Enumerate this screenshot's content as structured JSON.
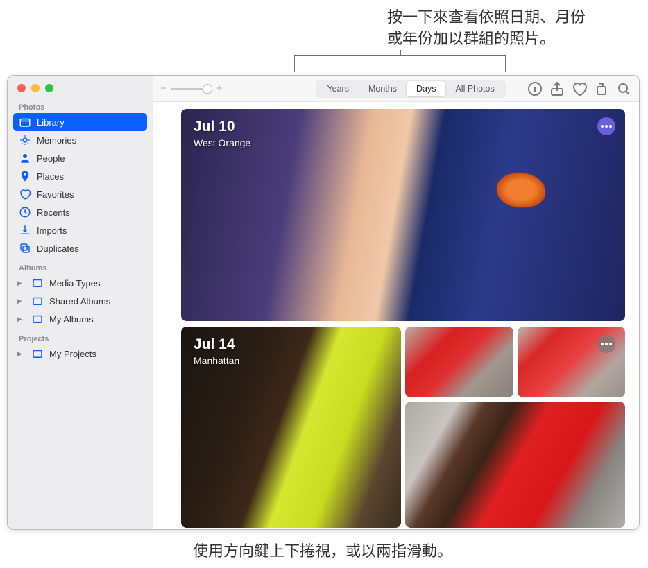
{
  "annotations": {
    "top_line1": "按一下來查看依照日期、月份",
    "top_line2": "或年份加以群組的照片。",
    "bottom": "使用方向鍵上下捲視，或以兩指滑動。"
  },
  "sidebar": {
    "sections": {
      "photos": "Photos",
      "albums": "Albums",
      "projects": "Projects"
    },
    "library": "Library",
    "memories": "Memories",
    "people": "People",
    "places": "Places",
    "favorites": "Favorites",
    "recents": "Recents",
    "imports": "Imports",
    "duplicates": "Duplicates",
    "media_types": "Media Types",
    "shared_albums": "Shared Albums",
    "my_albums": "My Albums",
    "my_projects": "My Projects"
  },
  "toolbar": {
    "zoom_out": "−",
    "zoom_in": "+",
    "years": "Years",
    "months": "Months",
    "days": "Days",
    "all_photos": "All Photos"
  },
  "groups": [
    {
      "date": "Jul 10",
      "location": "West Orange"
    },
    {
      "date": "Jul 14",
      "location": "Manhattan"
    }
  ]
}
